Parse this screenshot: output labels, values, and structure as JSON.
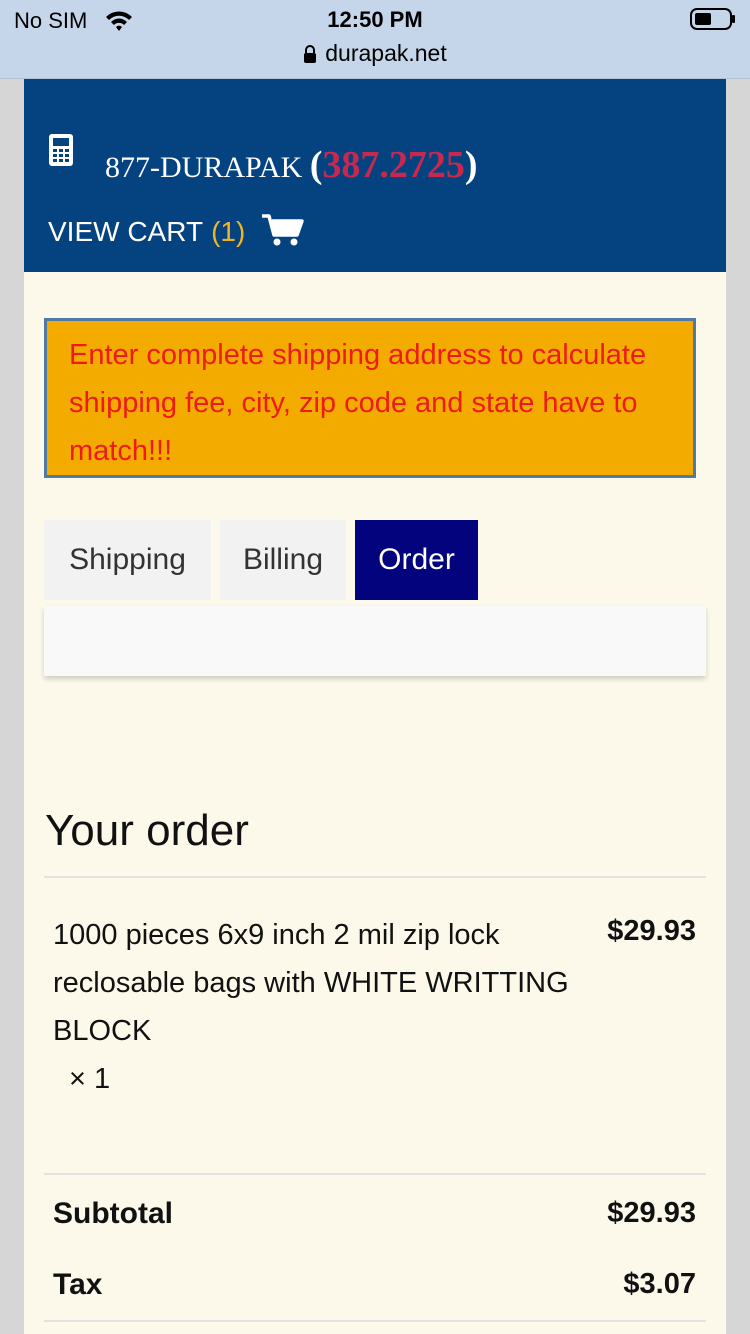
{
  "status": {
    "carrier": "No SIM",
    "time": "12:50 PM",
    "url": "durapak.net"
  },
  "header": {
    "phone_prefix": "877-DURAPAK ",
    "paren_open": "(",
    "phone_number": "387.2725",
    "paren_close": ")",
    "view_cart_label": "VIEW CART",
    "cart_count": "(1)"
  },
  "notice": {
    "text": "Enter complete shipping address to calculate shipping fee, city, zip code and state have to match!!!",
    "background": "#f4ab00",
    "text_color": "#ee1b1b"
  },
  "tabs": [
    {
      "label": "Shipping",
      "active": false
    },
    {
      "label": "Billing",
      "active": false
    },
    {
      "label": "Order",
      "active": true
    }
  ],
  "order": {
    "title": "Your order",
    "item": {
      "name": "1000 pieces 6x9 inch 2 mil zip lock reclosable bags with WHITE WRITTING BLOCK",
      "quantity": "× 1",
      "price": "$29.93"
    },
    "subtotal_label": "Subtotal",
    "subtotal_value": "$29.93",
    "tax_label": "Tax",
    "tax_value": "$3.07"
  },
  "colors": {
    "header_bg": "#054380",
    "phone_accent": "#c9284e",
    "cart_count": "#f1b523",
    "active_tab": "#02037d",
    "page_bg": "#fcf9eb"
  },
  "icons": [
    "wifi-icon",
    "battery-icon",
    "lock-icon",
    "phone-icon",
    "cart-icon"
  ]
}
